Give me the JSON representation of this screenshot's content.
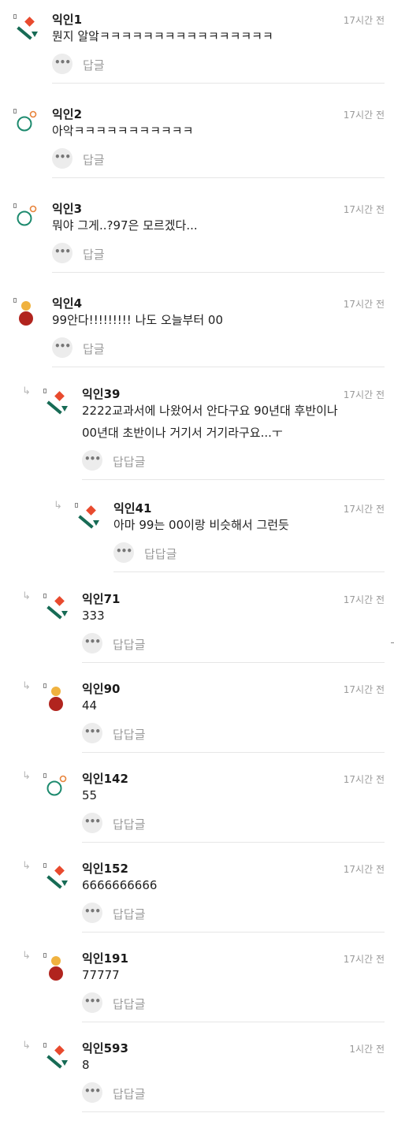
{
  "comments": [
    {
      "name": "익인1",
      "time": "17시간 전",
      "lines": [
        "뭔지 알앜ㅋㅋㅋㅋㅋㅋㅋㅋㅋㅋㅋㅋㅋㅋㅋㅋ"
      ],
      "reply": "답글",
      "avatar": "diamond"
    },
    {
      "name": "익인2",
      "time": "17시간 전",
      "lines": [
        "아악ㅋㅋㅋㅋㅋㅋㅋㅋㅋㅋㅋ"
      ],
      "reply": "답글",
      "avatar": "circle"
    },
    {
      "name": "익인3",
      "time": "17시간 전",
      "lines": [
        "뭐야 그게..?97은 모르겠다..."
      ],
      "reply": "답글",
      "avatar": "circle"
    },
    {
      "name": "익인4",
      "time": "17시간 전",
      "lines": [
        "99안다!!!!!!!!! 나도 오늘부터 00"
      ],
      "reply": "답글",
      "avatar": "person"
    },
    {
      "name": "익인39",
      "time": "17시간 전",
      "lines": [
        "2222교과서에 나왔어서 안다구요 90년대 후반이나",
        "00년대 초반이나 거기서 거기라구요...ㅜ"
      ],
      "reply": "답답글",
      "avatar": "diamond"
    },
    {
      "name": "익인41",
      "time": "17시간 전",
      "lines": [
        "아마 99는 00이랑 비슷해서 그런듯"
      ],
      "reply": "답답글",
      "avatar": "diamond"
    },
    {
      "name": "익인71",
      "time": "17시간 전",
      "lines": [
        "333"
      ],
      "reply": "답답글",
      "avatar": "diamond"
    },
    {
      "name": "익인90",
      "time": "17시간 전",
      "lines": [
        "44"
      ],
      "reply": "답답글",
      "avatar": "person"
    },
    {
      "name": "익인142",
      "time": "17시간 전",
      "lines": [
        "55"
      ],
      "reply": "답답글",
      "avatar": "circle"
    },
    {
      "name": "익인152",
      "time": "17시간 전",
      "lines": [
        "6666666666"
      ],
      "reply": "답답글",
      "avatar": "diamond"
    },
    {
      "name": "익인191",
      "time": "17시간 전",
      "lines": [
        "77777"
      ],
      "reply": "답답글",
      "avatar": "person"
    },
    {
      "name": "익인593",
      "time": "1시간 전",
      "lines": [
        "8"
      ],
      "reply": "답답글",
      "avatar": "diamond"
    }
  ],
  "icons": {
    "more": "more-dots-icon",
    "reply_arrow": "reply-arrow-icon"
  }
}
